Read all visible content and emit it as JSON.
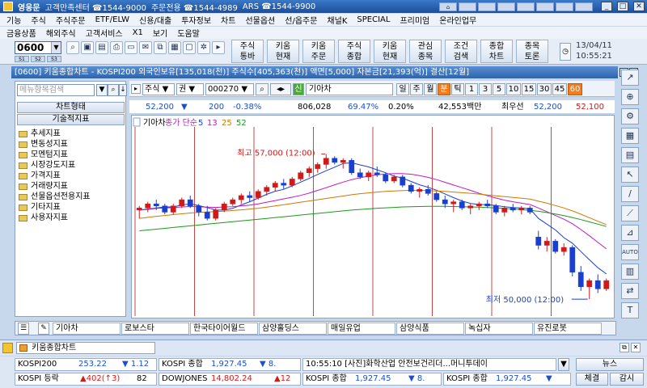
{
  "window": {
    "app_name": "영웅문",
    "hotlines": [
      "고객만족센터 ☎1544-9000",
      "주문전용 ☎1544-4989",
      "ARS ☎1544-9900"
    ]
  },
  "menu1": [
    "기능",
    "주식",
    "주식주문",
    "ETF/ELW",
    "신용/대출",
    "투자정보",
    "차트",
    "선물옵션",
    "선/옵주문",
    "채널K",
    "SPECIAL",
    "프리미엄",
    "온라인업무"
  ],
  "menu2": [
    "금융상품",
    "해외주식",
    "고객서비스",
    "X1",
    "보기",
    "도움말"
  ],
  "toolbar": {
    "screen_no": "0600",
    "sub_tabs": [
      "S1",
      "S2",
      "S3"
    ],
    "buttons": [
      {
        "l1": "주식",
        "l2": "통바"
      },
      {
        "l1": "키움",
        "l2": "현재"
      },
      {
        "l1": "키움",
        "l2": "주문"
      },
      {
        "l1": "주식",
        "l2": "종합"
      },
      {
        "l1": "키움",
        "l2": "현재"
      },
      {
        "l1": "관심",
        "l2": "종목"
      },
      {
        "l1": "조건",
        "l2": "검색"
      },
      {
        "l1": "종합",
        "l2": "차트"
      },
      {
        "l1": "종목",
        "l2": "토론"
      }
    ],
    "date": "13/04/11",
    "time": "10:55:21"
  },
  "chart_window": {
    "title": "[0600] 키움종합차트 - KOSPI200 외국인보유[135,018(천)] 주식수[405,363(천)] 액면[5,000] 자본금[21,393(억)] 결산[12월]"
  },
  "left_panel": {
    "search_placeholder": "메뉴항목검색",
    "btn_chart_type": "차트형태",
    "btn_tech": "기술적지표",
    "tree": [
      "추세지표",
      "변동성지표",
      "모멘텀지표",
      "시장강도지표",
      "가격지표",
      "거래량지표",
      "선물옵션전용지표",
      "기타지표",
      "사용자지표"
    ]
  },
  "chart_tools": {
    "market": "주식",
    "type": "권",
    "code": "000270",
    "stock_name": "기아차",
    "periods": [
      "일",
      "주",
      "월",
      "분",
      "틱",
      "1",
      "3",
      "5",
      "10",
      "15",
      "30",
      "45",
      "60"
    ],
    "selected_periods": [
      "분",
      "60"
    ]
  },
  "info_row": {
    "price": "52,200",
    "change_arrow": "▼",
    "change": "200",
    "change_pct": "-0.38%",
    "volume": "806,028",
    "vol_ratio": "69.47%",
    "turnover": "0.20%",
    "amount": "42,553백만",
    "label_best": "최우선",
    "ask": "52,200",
    "bid": "52,100"
  },
  "chart_data": {
    "type": "candlestick",
    "legend_stock": "기아차",
    "legend_ma_label": "종가 단순",
    "ma_periods": [
      "5",
      "13",
      "25",
      "52"
    ],
    "ma_colors": [
      "#1a3fd0",
      "#c01ac0",
      "#d07800",
      "#1a9a1a"
    ],
    "up_color": "#d01a1a",
    "down_color": "#1a3fd0",
    "high_label": "최고 57,000 (12:00)",
    "low_label": "최저 50,000 (12:00)",
    "ylim": [
      49500,
      58000
    ],
    "candles": [
      [
        54300,
        54500,
        53900,
        54400
      ],
      [
        54400,
        54700,
        54200,
        54600
      ],
      [
        54600,
        54800,
        54300,
        54500
      ],
      [
        54500,
        54600,
        54100,
        54200
      ],
      [
        54200,
        54600,
        54100,
        54500
      ],
      [
        54500,
        54900,
        54400,
        54800
      ],
      [
        54800,
        55000,
        54400,
        54500
      ],
      [
        54500,
        54600,
        54000,
        54200
      ],
      [
        54200,
        54500,
        53800,
        53900
      ],
      [
        53900,
        54400,
        53800,
        54300
      ],
      [
        54300,
        54700,
        54200,
        54600
      ],
      [
        54600,
        54900,
        54500,
        54800
      ],
      [
        54800,
        55100,
        54600,
        55000
      ],
      [
        55000,
        55200,
        54700,
        54900
      ],
      [
        54900,
        55300,
        54800,
        55200
      ],
      [
        55200,
        55500,
        55000,
        55400
      ],
      [
        55400,
        55700,
        55200,
        55600
      ],
      [
        55600,
        55800,
        55300,
        55500
      ],
      [
        55500,
        55900,
        55400,
        55800
      ],
      [
        55800,
        56200,
        55700,
        56100
      ],
      [
        56100,
        56400,
        55900,
        56300
      ],
      [
        56300,
        56600,
        56100,
        56500
      ],
      [
        56500,
        57000,
        56300,
        56800
      ],
      [
        56800,
        56900,
        56500,
        56600
      ],
      [
        56600,
        56800,
        56300,
        56700
      ],
      [
        56700,
        56800,
        56000,
        56100
      ],
      [
        56100,
        56300,
        55800,
        55900
      ],
      [
        55900,
        56200,
        55700,
        56100
      ],
      [
        56100,
        56400,
        55900,
        56000
      ],
      [
        56000,
        56100,
        55600,
        55700
      ],
      [
        55700,
        56000,
        55600,
        55900
      ],
      [
        55900,
        56000,
        55400,
        55500
      ],
      [
        55500,
        55600,
        55100,
        55200
      ],
      [
        55200,
        55400,
        54900,
        55300
      ],
      [
        55300,
        55500,
        55000,
        55100
      ],
      [
        55100,
        55200,
        54700,
        54800
      ],
      [
        54800,
        55000,
        54400,
        54600
      ],
      [
        54600,
        54800,
        54200,
        54700
      ],
      [
        54700,
        54800,
        54300,
        54400
      ],
      [
        54400,
        54600,
        54100,
        54500
      ],
      [
        54500,
        54700,
        54300,
        54600
      ],
      [
        54600,
        54800,
        54400,
        54500
      ],
      [
        54500,
        54600,
        54100,
        54200
      ],
      [
        54200,
        54500,
        54000,
        54400
      ],
      [
        54400,
        54600,
        54200,
        54300
      ],
      [
        54300,
        54500,
        54100,
        54400
      ],
      [
        54400,
        54500,
        54100,
        54200
      ],
      [
        53000,
        53300,
        52400,
        52600
      ],
      [
        52600,
        53000,
        52300,
        52800
      ],
      [
        52800,
        52900,
        52200,
        52300
      ],
      [
        52300,
        52700,
        52100,
        52500
      ],
      [
        52500,
        52600,
        51100,
        51300
      ],
      [
        51300,
        51600,
        50400,
        50600
      ],
      [
        50600,
        51000,
        50000,
        50900
      ],
      [
        50900,
        51200,
        50300,
        50500
      ],
      [
        50500,
        51000,
        50400,
        50900
      ]
    ],
    "ma_series": [
      {
        "name": "5",
        "values": [
          54300,
          54350,
          54400,
          54450,
          54450,
          54550,
          54600,
          54520,
          54420,
          54300,
          54300,
          54380,
          54550,
          54700,
          54880,
          55060,
          55210,
          55300,
          55470,
          55650,
          55830,
          56020,
          56200,
          56370,
          56550,
          56580,
          56480,
          56380,
          56240,
          56100,
          55940,
          55840,
          55680,
          55520,
          55400,
          55260,
          55080,
          54900,
          54740,
          54620,
          54570,
          54560,
          54520,
          54460,
          54420,
          54400,
          54360,
          53900,
          53620,
          53340,
          52970,
          52700,
          52300,
          51900,
          51520,
          51220
        ]
      },
      {
        "name": "13",
        "values": [
          54300,
          54330,
          54380,
          54400,
          54420,
          54450,
          54470,
          54460,
          54440,
          54430,
          54450,
          54460,
          54500,
          54540,
          54600,
          54680,
          54760,
          54840,
          54920,
          55010,
          55120,
          55250,
          55380,
          55520,
          55650,
          55770,
          55860,
          55940,
          56000,
          56040,
          56060,
          56060,
          56030,
          55960,
          55880,
          55770,
          55640,
          55510,
          55380,
          55250,
          55110,
          54990,
          54880,
          54780,
          54700,
          54630,
          54570,
          54400,
          54220,
          54040,
          53860,
          53640,
          53360,
          53060,
          52740,
          52430
        ]
      },
      {
        "name": "25",
        "values": [
          53900,
          53950,
          54000,
          54040,
          54080,
          54120,
          54160,
          54190,
          54210,
          54230,
          54250,
          54280,
          54310,
          54350,
          54390,
          54440,
          54500,
          54560,
          54620,
          54680,
          54740,
          54800,
          54860,
          54920,
          54980,
          55040,
          55090,
          55130,
          55170,
          55200,
          55220,
          55240,
          55250,
          55250,
          55240,
          55220,
          55200,
          55170,
          55140,
          55110,
          55070,
          55030,
          54990,
          54950,
          54910,
          54870,
          54830,
          54730,
          54630,
          54520,
          54400,
          54260,
          54100,
          53930,
          53760,
          53600
        ]
      },
      {
        "name": "52",
        "values": [
          53300,
          53340,
          53380,
          53420,
          53460,
          53500,
          53540,
          53580,
          53620,
          53660,
          53700,
          53740,
          53780,
          53820,
          53860,
          53900,
          53940,
          53980,
          54020,
          54060,
          54100,
          54140,
          54180,
          54220,
          54260,
          54300,
          54330,
          54360,
          54390,
          54410,
          54430,
          54450,
          54460,
          54470,
          54480,
          54480,
          54480,
          54470,
          54460,
          54450,
          54440,
          54420,
          54400,
          54380,
          54350,
          54320,
          54290,
          54240,
          54180,
          54110,
          54030,
          53940,
          53840,
          53730,
          53620,
          53510
        ]
      }
    ]
  },
  "right_tools": [
    "cursor",
    "crosshair",
    "trendline",
    "hline",
    "vline",
    "fibonacci",
    "text",
    "zoom-in",
    "zoom-out",
    "settings",
    "candle",
    "cycle",
    "text-tool"
  ],
  "right_tool_labels": [
    "↗",
    "⊕",
    "⚙",
    "▦",
    "▤",
    "↖",
    "/",
    "⟋",
    "⊿",
    "AUTO",
    "▥",
    "⇄",
    "T"
  ],
  "stock_tabs": [
    "기아차",
    "로보스타",
    "한국타이어월드",
    "삼양홀딩스",
    "매일유업",
    "삼양식품",
    "녹십자",
    "유진로봇"
  ],
  "taskbar": {
    "item": "키움종합차트"
  },
  "ticker": {
    "r1": [
      {
        "name": "KOSPI200",
        "val": "253.22",
        "chg": "▼ 1.12"
      },
      {
        "name": "KOSPI 종합",
        "val": "1,927.45",
        "chg": "▼ 8."
      },
      {
        "news": "10:55:10 [사진]화학산업 안전보건리더...머니투데이"
      }
    ],
    "r2": [
      {
        "name": "KOSPI 등락",
        "val": "▲402(↑3)",
        "chg": "82"
      },
      {
        "name": "DOWJONES",
        "val": "14,802.24",
        "chg": "▲12"
      },
      {
        "name": "KOSPI 종합",
        "val": "1,927.45",
        "chg": "▼ 8."
      },
      {
        "name": "KOSPI 종합",
        "val": "1,927.45",
        "chg": "▼"
      }
    ],
    "news_btn": "뉴스",
    "conclude_btn": "체결",
    "monitor_btn": "감시"
  }
}
